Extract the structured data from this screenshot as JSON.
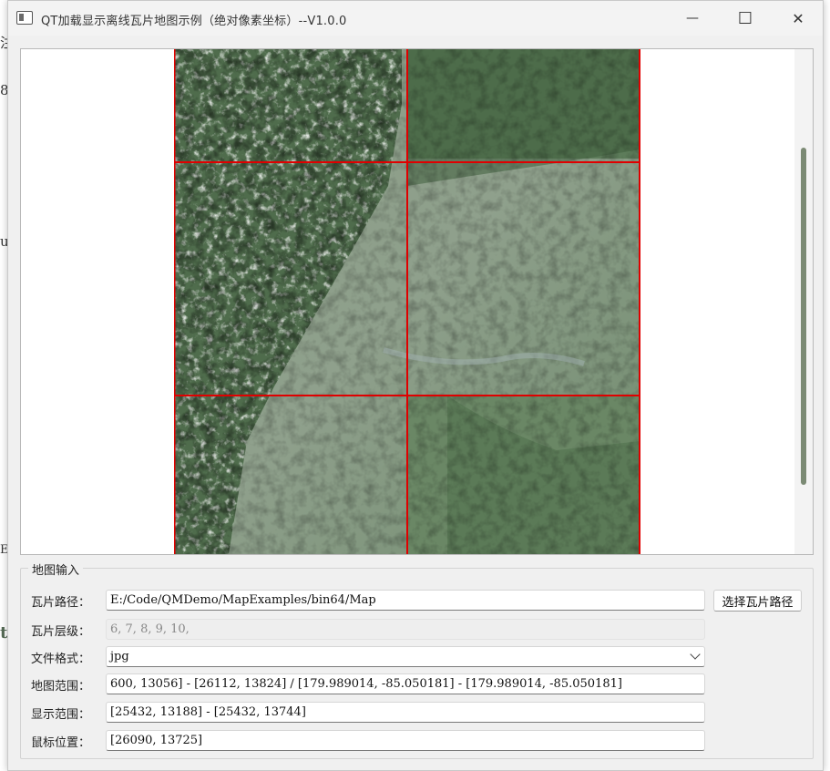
{
  "window": {
    "title": "QT加载显示离线瓦片地图示例（绝对像素坐标）--V1.0.0",
    "minimize_glyph": "—",
    "maximize_glyph": "☐",
    "close_glyph": "✕"
  },
  "background_glyphs": [
    "注",
    "8",
    "u",
    "t",
    "Ex"
  ],
  "map": {
    "grid_color": "#e00000",
    "scroll_thumb_color": "#7b8a74"
  },
  "input_group": {
    "title": "地图输入",
    "tile_path": {
      "label": "瓦片路径：",
      "value": "E:/Code/QMDemo/MapExamples/bin64/Map",
      "button": "选择瓦片路径"
    },
    "tile_levels": {
      "label": "瓦片层级：",
      "value": "6, 7, 8, 9, 10,"
    },
    "file_format": {
      "label": "文件格式：",
      "value": "jpg"
    },
    "map_range": {
      "label": "地图范围：",
      "value": "600, 13056] - [26112, 13824] / [179.989014, -85.050181] - [179.989014, -85.050181]"
    },
    "display_range": {
      "label": "显示范围：",
      "value": "[25432, 13188] - [25432, 13744]"
    },
    "mouse_position": {
      "label": "鼠标位置：",
      "value": "[26090, 13725]"
    }
  }
}
